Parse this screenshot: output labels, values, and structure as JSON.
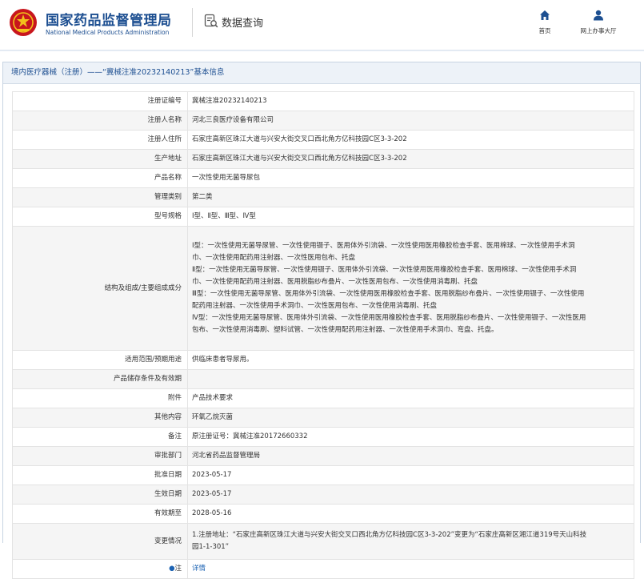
{
  "header": {
    "logo_cn": "国家药品监督管理局",
    "logo_en": "National Medical Products Administration",
    "query_title": "数据查询",
    "nav": [
      {
        "label": "首页",
        "icon": "home-icon"
      },
      {
        "label": "网上办事大厅",
        "icon": "user-icon"
      }
    ],
    "brand_color": "#1d4f91",
    "emblem_color": "#c8161d"
  },
  "panel": {
    "title": "境内医疗器械（注册）——“冀械注准20232140213”基本信息"
  },
  "rows": [
    {
      "label": "注册证编号",
      "value": "冀械注准20232140213"
    },
    {
      "label": "注册人名称",
      "value": "河北三良医疗设备有限公司"
    },
    {
      "label": "注册人住所",
      "value": "石家庄高新区珠江大道与兴安大街交叉口西北角方亿科技园C区3-3-202"
    },
    {
      "label": "生产地址",
      "value": "石家庄高新区珠江大道与兴安大街交叉口西北角方亿科技园C区3-3-202"
    },
    {
      "label": "产品名称",
      "value": "一次性使用无菌导尿包"
    },
    {
      "label": "管理类别",
      "value": "第二类"
    },
    {
      "label": "型号规格",
      "value": "Ⅰ型、Ⅱ型、Ⅲ型、Ⅳ型"
    },
    {
      "label": "结构及组成/主要组成成分",
      "value": "Ⅰ型：一次性使用无菌导尿管、一次性使用镊子、医用体外引流袋、一次性使用医用橡胶检查手套、医用棉球、一次性使用手术洞\n巾、一次性使用配药用注射器、一次性医用包布、托盘\nⅡ型：一次性使用无菌导尿管、一次性使用镊子、医用体外引流袋、一次性使用医用橡胶检查手套、医用棉球、一次性使用手术洞\n巾、一次性使用配药用注射器、医用脱脂纱布叠片、一次性医用包布、一次性使用消毒刷、托盘\nⅢ型：一次性使用无菌导尿管、医用体外引流袋、一次性使用医用橡胶检查手套、医用脱脂纱布叠片、一次性使用镊子、一次性使用\n配药用注射器、一次性使用手术洞巾、一次性医用包布、一次性使用消毒刷、托盘\nⅣ型：一次性使用无菌导尿管、医用体外引流袋、一次性使用医用橡胶检查手套、医用脱脂纱布叠片、一次性使用镊子、一次性医用\n包布、一次性使用消毒刷、塑料试管、一次性使用配药用注射器、一次性使用手术洞巾、弯盘、托盘。"
    },
    {
      "label": "适用范围/预期用途",
      "value": "供临床患者导尿用。"
    },
    {
      "label": "产品储存条件及有效期",
      "value": ""
    },
    {
      "label": "附件",
      "value": "产品技术要求"
    },
    {
      "label": "其他内容",
      "value": "环氧乙烷灭菌"
    },
    {
      "label": "备注",
      "value": "原注册证号：冀械注准20172660332"
    },
    {
      "label": "审批部门",
      "value": "河北省药品监督管理局"
    },
    {
      "label": "批准日期",
      "value": "2023-05-17"
    },
    {
      "label": "生效日期",
      "value": "2023-05-17"
    },
    {
      "label": "有效期至",
      "value": "2028-05-16"
    },
    {
      "label": "变更情况",
      "value": "1.注册地址：“石家庄高新区珠江大道与兴安大街交叉口西北角方亿科技园C区3-3-202”变更为“石家庄高新区湘江道319号天山科技\n园1-1-301”"
    },
    {
      "label": "注",
      "value": "详情",
      "icon": "pin-icon"
    }
  ]
}
